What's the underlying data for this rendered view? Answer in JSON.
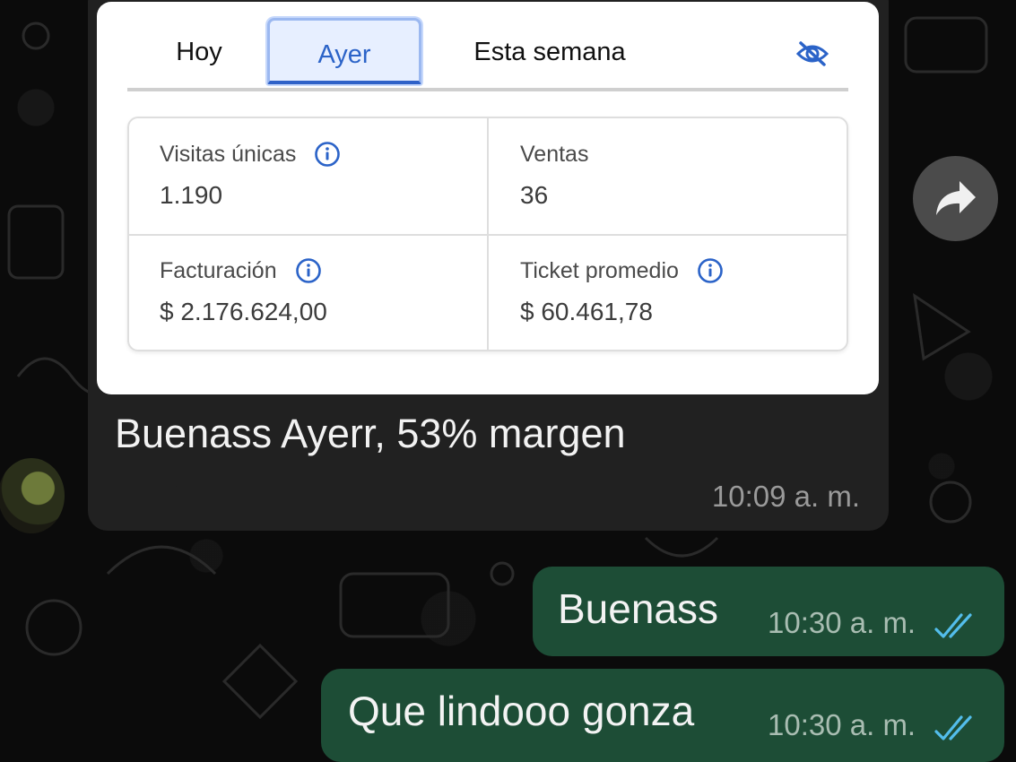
{
  "shared_card": {
    "tabs": [
      "Hoy",
      "Ayer",
      "Esta semana"
    ],
    "selected_tab": "Ayer",
    "visibility_icon": "eye-off-icon",
    "metrics": [
      {
        "label": "Visitas únicas",
        "value": "1.190",
        "has_info": true
      },
      {
        "label": "Ventas",
        "value": "36",
        "has_info": false
      },
      {
        "label": "Facturación",
        "value": "$ 2.176.624,00",
        "has_info": true
      },
      {
        "label": "Ticket promedio",
        "value": "$ 60.461,78",
        "has_info": true
      }
    ]
  },
  "incoming_message": {
    "text": "Buenass Ayerr, 53% margen",
    "time": "10:09 a. m."
  },
  "outgoing_messages": [
    {
      "text": "Buenass",
      "time": "10:30 a. m.",
      "status": "read"
    },
    {
      "text": "Que lindooo gonza",
      "time": "10:30 a. m.",
      "status": "read"
    }
  ],
  "icons": {
    "forward": "forward-arrow-icon",
    "info": "info-icon",
    "read_receipt": "double-check-icon"
  },
  "colors": {
    "accent_blue": "#2b63c8",
    "incoming_bubble": "#212121",
    "outgoing_bubble": "#1d4d36",
    "read_ticks": "#53bdeb"
  }
}
